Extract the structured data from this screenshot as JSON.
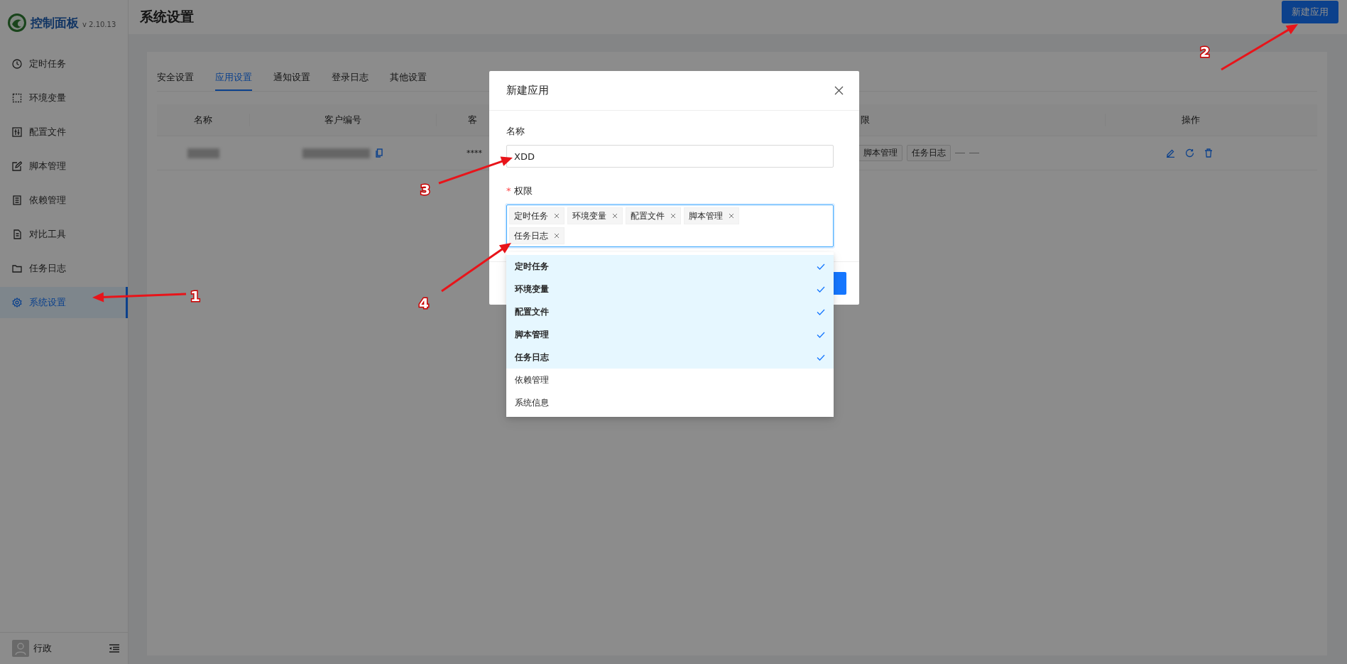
{
  "sidebar": {
    "logo_title": "控制面板",
    "version": "v 2.10.13",
    "items": [
      {
        "label": "定时任务",
        "selected": false
      },
      {
        "label": "环境变量",
        "selected": false
      },
      {
        "label": "配置文件",
        "selected": false
      },
      {
        "label": "脚本管理",
        "selected": false
      },
      {
        "label": "依赖管理",
        "selected": false
      },
      {
        "label": "对比工具",
        "selected": false
      },
      {
        "label": "任务日志",
        "selected": false
      },
      {
        "label": "系统设置",
        "selected": true
      }
    ],
    "user": "行政"
  },
  "header": {
    "title": "系统设置",
    "new_button": "新建应用"
  },
  "tabs": [
    {
      "label": "安全设置",
      "selected": false
    },
    {
      "label": "应用设置",
      "selected": true
    },
    {
      "label": "通知设置",
      "selected": false
    },
    {
      "label": "登录日志",
      "selected": false
    },
    {
      "label": "其他设置",
      "selected": false
    }
  ],
  "table": {
    "columns": [
      "名称",
      "客户编号",
      "客",
      "限",
      "操作"
    ],
    "rows": [
      {
        "secret": "****",
        "tags": [
          "脚本管理",
          "任务日志"
        ]
      }
    ]
  },
  "dialog": {
    "title": "新建应用",
    "name_label": "名称",
    "name_value": "XDD",
    "perm_label": "权限",
    "required_mark": "*",
    "tags": [
      "定时任务",
      "环境变量",
      "配置文件",
      "脚本管理",
      "任务日志"
    ],
    "options": [
      {
        "label": "定时任务",
        "selected": true
      },
      {
        "label": "环境变量",
        "selected": true
      },
      {
        "label": "配置文件",
        "selected": true
      },
      {
        "label": "脚本管理",
        "selected": true
      },
      {
        "label": "任务日志",
        "selected": true
      },
      {
        "label": "依赖管理",
        "selected": false
      },
      {
        "label": "系统信息",
        "selected": false
      }
    ]
  },
  "annotations": [
    "1",
    "2",
    "3",
    "4"
  ]
}
